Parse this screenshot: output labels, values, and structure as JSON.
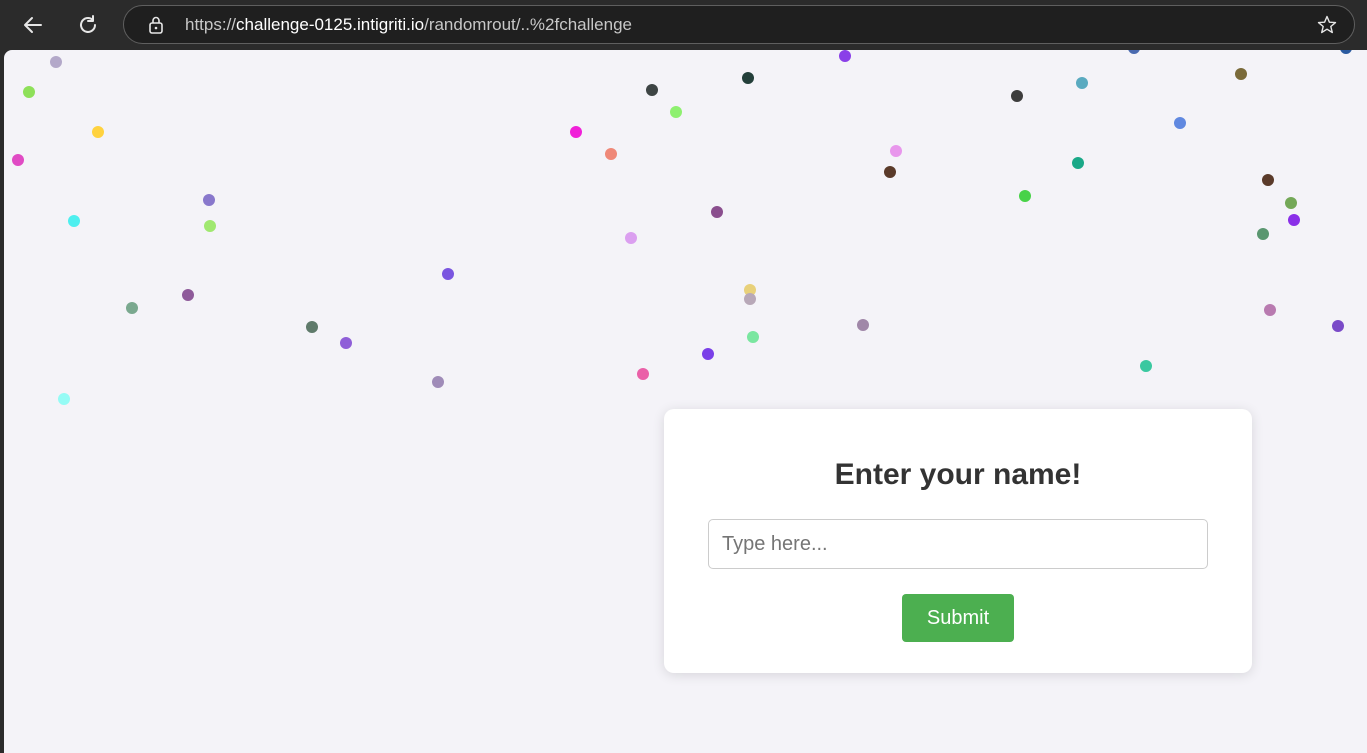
{
  "browser": {
    "url_scheme": "https://",
    "url_host": "challenge-0125.intigriti.io",
    "url_path": "/randomrout/..%2fchallenge",
    "icons": [
      "back-arrow-icon",
      "reload-icon",
      "lock-icon",
      "star-icon"
    ]
  },
  "form": {
    "title": "Enter your name!",
    "input_placeholder": "Type here...",
    "input_value": "",
    "submit_label": "Submit",
    "submit_color": "#4caf50"
  },
  "confetti_colors": [
    "#b3a8c9",
    "#8ee05a",
    "#ffd23f",
    "#e04ac4",
    "#4eefef",
    "#8877cc",
    "#a0e870",
    "#7aa88f",
    "#8e5a9a",
    "#5f7a6b",
    "#8f5ed8",
    "#9f8bb8",
    "#95fbf5",
    "#7a55e0",
    "#f020d8",
    "#ef8878",
    "#3d4444",
    "#8ef070",
    "#233f3a",
    "#db9ff0",
    "#8a4e8e",
    "#e8d07a",
    "#b8a8b8",
    "#7ae6a0",
    "#7a3fe8",
    "#ea60a8",
    "#8a3fe8",
    "#e896ec",
    "#5a3a2a",
    "#a087a8",
    "#3d3d3d",
    "#5aaac0",
    "#48d248",
    "#1aa888",
    "#4a6ab0",
    "#6088e0",
    "#3ac8a0",
    "#7a6a3a",
    "#5a3a2a",
    "#74a858",
    "#5a9670",
    "#8a2fe8",
    "#b87ab0",
    "#7a4ac8",
    "#2a5aa0",
    "#e08060"
  ]
}
